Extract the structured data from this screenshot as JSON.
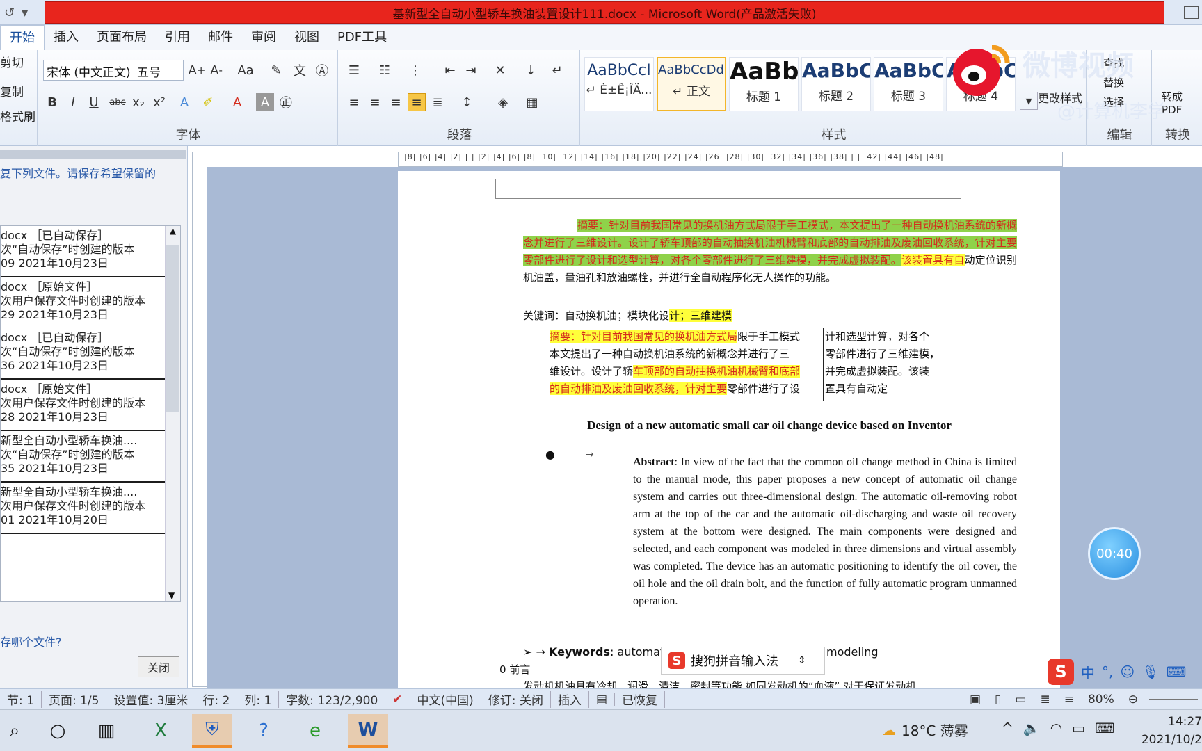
{
  "window": {
    "title": "基新型全自动小型轿车换油装置设计111.docx - Microsoft Word(产品激活失败)"
  },
  "menu": {
    "tabs": [
      "开始",
      "插入",
      "页面布局",
      "引用",
      "邮件",
      "审阅",
      "视图",
      "PDF工具"
    ]
  },
  "ribbon": {
    "clipboard": {
      "cut": "剪切",
      "copy": "复制",
      "format_painter": "格式刷"
    },
    "font": {
      "label": "字体",
      "font_name": "宋体 (中文正文)",
      "font_size": "五号"
    },
    "paragraph": {
      "label": "段落"
    },
    "styles": {
      "label": "样式",
      "tiles": [
        {
          "sample": "AaBbCcI",
          "name": "↵ È±Ê¡ÎÄ..."
        },
        {
          "sample": "AaBbCcDdI",
          "name": "↵ 正文"
        },
        {
          "sample": "AaBb",
          "name": "标题 1"
        },
        {
          "sample": "AaBbC",
          "name": "标题 2"
        },
        {
          "sample": "AaBbC",
          "name": "标题 3"
        },
        {
          "sample": "AaBbCc",
          "name": "标题 4"
        }
      ],
      "change_styles": "更改样式"
    },
    "edit": {
      "label": "编辑",
      "find": "查找",
      "replace": "替换",
      "select": "选择"
    },
    "convert": {
      "label": "转换",
      "to_pdf": "转成PDF"
    }
  },
  "recovery_pane": {
    "intro": "复下列文件。请保存希望保留的",
    "files": [
      {
        "name": "docx ［已自动保存］",
        "desc": "次“自动保存”时创建的版本",
        "time": "09  2021年10月23日"
      },
      {
        "name": "docx ［原始文件］",
        "desc": "次用户保存文件时创建的版本",
        "time": "29  2021年10月23日"
      },
      {
        "name": "docx ［已自动保存］",
        "desc": "次“自动保存”时创建的版本",
        "time": "36  2021年10月23日"
      },
      {
        "name": "docx ［原始文件］",
        "desc": "次用户保存文件时创建的版本",
        "time": "28  2021年10月23日"
      },
      {
        "name": "新型全自动小型轿车换油....",
        "desc": "次“自动保存”时创建的版本",
        "time": "35  2021年10月23日"
      },
      {
        "name": "新型全自动小型轿车换油....",
        "desc": "次用户保存文件时创建的版本",
        "time": "01  2021年10月20日"
      }
    ],
    "question": "存哪个文件?",
    "close_label": "关闭"
  },
  "ruler": {
    "corner": "L",
    "ticks": "|8| |6| |4| |2| | | |2| |4| |6| |8| |10| |12| |14| |16| |18| |20| |22| |24| |26| |28| |30| |32| |34| |36| |38| | | |42| |44| |46| |48|"
  },
  "document": {
    "abstract_cn": {
      "label": "摘要：",
      "green_part": "针对目前我国常见的换机油方式局限于手工模式，本文提出了一种自动换机油系统的新概念并进行了三维设计。设计了轿车顶部的自动抽换机油机械臂和底部的自动排油及废油回收系统，针对主要零部件进行了设计和选型计算，对各个零部件进行了三维建模，并完成虚拟装配。",
      "yellow_part": "该装置具有自",
      "plain_part": "动定位识别机油盖，量油孔和放油螺栓，并进行全自动程序化无人操作的功能。"
    },
    "keywords_cn": {
      "plain": "关键词：自动换机油；模块化设",
      "yellow": "计；三维建模"
    },
    "textbox": {
      "col1_a": "摘要：针对目前我国常见的换机油方式局",
      "col1_b": "限于手工模式",
      "col1_c": "本文提出了一种自动换机油系统的新概念并进行了三",
      "col1_d": "维设计。设计了轿",
      "col1_e": "车顶部的自动抽换机油机械臂和底部",
      "col1_f": "的自动排油及废油回收系统，针对主要",
      "col1_g": "零部件进行了设",
      "col2_a": "计和选型计算，对各个",
      "col2_b": "零部件进行了三维建模，",
      "col2_c": "并完成虚拟装配。该装",
      "col2_d": "置具有自动定"
    },
    "title_en": "Design of a new automatic small car oil change device based on Inventor",
    "abstract_en_label": "Abstract",
    "abstract_en": ": In view of the fact that the common oil change method in China is limited to the manual mode, this paper proposes a new concept of automatic oil change system and carries out three-dimensional design. The automatic oil-removing robot arm at the top of the car and the automatic oil-discharging and waste oil recovery system at the bottom were designed. The main components were designed and selected, and each component was modeled in three dimensions and virtual assembly was completed. The device has an automatic positioning to identify the oil cover, the oil hole and the oil drain bolt, and the function of fully automatic program unmanned operation.",
    "keywords_en_label": "Keywords",
    "keywords_en_a": ": automatic",
    "keywords_en_b": "modeling",
    "preface": "0 前言",
    "body_cut": "发动机机油具有冷却、润滑、清洁、密封等功能,如同发动机的“血液”,对于保证发动机"
  },
  "ime_popup": {
    "label": "搜狗拼音输入法"
  },
  "ime_tray": {
    "lang": "中",
    "punct": "°,"
  },
  "timer": "00:40",
  "watermark": {
    "line1": "微博视频",
    "line2": "@计算机李学"
  },
  "status": {
    "section": "节: 1",
    "page": "页面: 1/5",
    "setting": "设置值: 3厘米",
    "row": "行: 2",
    "col": "列: 1",
    "words": "字数: 123/2,900",
    "lang": "中文(中国)",
    "track": "修订: 关闭",
    "insert": "插入",
    "recovered": "已恢复",
    "zoom": "80%"
  },
  "taskbar": {
    "weather": "18°C  薄雾",
    "time": "14:27",
    "date": "2021/10/2"
  },
  "colors": {
    "title_red": "#e8251d",
    "highlight_green": "#8fd24a",
    "highlight_yellow": "#ffff3a",
    "text_red": "#d42b1c",
    "workspace": "#a9bad5"
  }
}
